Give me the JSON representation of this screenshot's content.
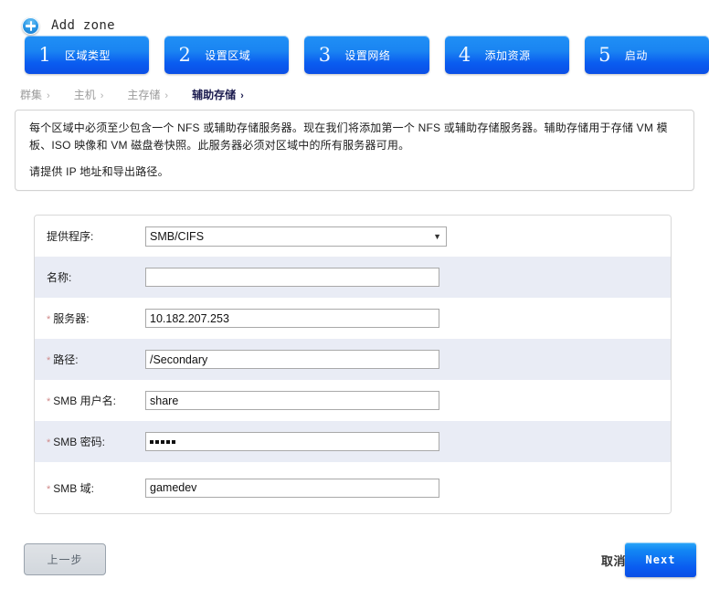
{
  "header": {
    "title": "Add zone",
    "icon": "plus-circle-icon"
  },
  "steps": [
    {
      "number": "1",
      "label": "区域类型"
    },
    {
      "number": "2",
      "label": "设置区域"
    },
    {
      "number": "3",
      "label": "设置网络"
    },
    {
      "number": "4",
      "label": "添加资源"
    },
    {
      "number": "5",
      "label": "启动"
    }
  ],
  "breadcrumb": [
    {
      "label": "群集",
      "chevron": "›",
      "active": false
    },
    {
      "label": "主机",
      "chevron": "›",
      "active": false
    },
    {
      "label": "主存储",
      "chevron": "›",
      "active": false
    },
    {
      "label": "辅助存储",
      "chevron": "›",
      "active": true
    }
  ],
  "info": {
    "line1": "每个区域中必须至少包含一个 NFS 或辅助存储服务器。现在我们将添加第一个 NFS 或辅助存储服务器。辅助存储用于存储 VM 模板、ISO 映像和 VM 磁盘卷快照。此服务器必须对区域中的所有服务器可用。",
    "line2": "请提供 IP 地址和导出路径。"
  },
  "form": {
    "provider": {
      "label": "提供程序:",
      "value": "SMB/CIFS",
      "options": [
        "SMB/CIFS"
      ],
      "required": false
    },
    "name": {
      "label": "名称:",
      "value": "",
      "placeholder": "",
      "required": false
    },
    "server": {
      "label": "服务器:",
      "value": "10.182.207.253",
      "placeholder": "",
      "required": true
    },
    "path": {
      "label": "路径:",
      "value": "/Secondary",
      "placeholder": "",
      "required": true
    },
    "smb_username": {
      "label": "SMB 用户名:",
      "value": "share",
      "placeholder": "",
      "required": true
    },
    "smb_password": {
      "label": "SMB 密码:",
      "value": "•••••",
      "dots": 5,
      "required": true
    },
    "smb_domain": {
      "label": "SMB 域:",
      "value": "gamedev",
      "placeholder": "",
      "required": true
    },
    "required_marker": "*"
  },
  "footer": {
    "previous_label": "上一步",
    "cancel_label": "取消",
    "next_label": "Next"
  },
  "colors": {
    "accent_blue": "#0a5cf0",
    "step_blue_top": "#2090f5",
    "stripe": "#e9ecf5",
    "required_red": "#d08a8a"
  }
}
